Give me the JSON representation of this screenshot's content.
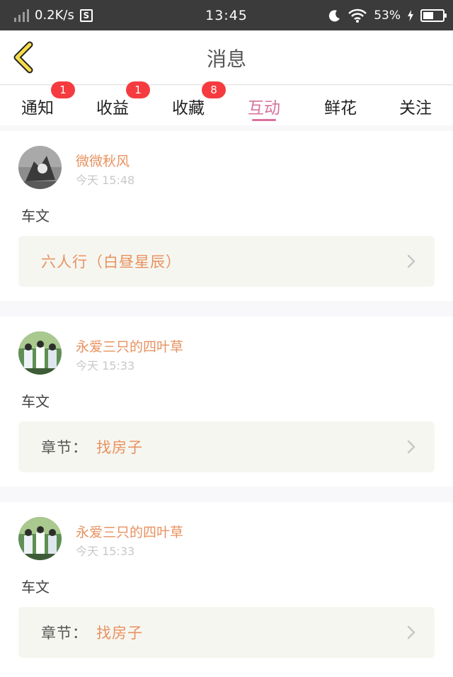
{
  "status_bar": {
    "speed": "0.2K/s",
    "s_icon_label": "S",
    "time": "13:45",
    "battery": "53%",
    "battery_level": 0.53
  },
  "header": {
    "title": "消息"
  },
  "tabs": [
    {
      "label": "通知",
      "badge": "1"
    },
    {
      "label": "收益",
      "badge": "1"
    },
    {
      "label": "收藏",
      "badge": "8"
    },
    {
      "label": "互动",
      "active": true
    },
    {
      "label": "鲜花"
    },
    {
      "label": "关注"
    }
  ],
  "feed": [
    {
      "user": "微微秋风",
      "time": "今天 15:48",
      "content": "车文",
      "link_prefix": "",
      "link_text": "六人行（白昼星辰）"
    },
    {
      "user": "永爱三只的四叶草",
      "time": "今天 15:33",
      "content": "车文",
      "link_prefix": "章节：",
      "link_text": "找房子"
    },
    {
      "user": "永爱三只的四叶草",
      "time": "今天 15:33",
      "content": "车文",
      "link_prefix": "章节：",
      "link_text": "找房子"
    }
  ],
  "colors": {
    "accent": "#d9719c",
    "username": "#e8915f",
    "badge": "#f53b3f",
    "status_bar": "#3b3b3b",
    "back_arrow": "#f6dd4a"
  }
}
